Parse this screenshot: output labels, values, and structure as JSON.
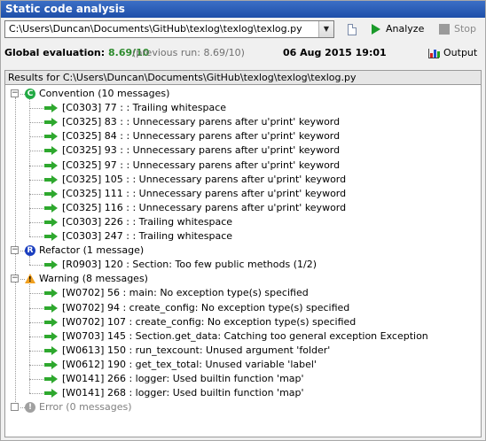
{
  "window": {
    "title": "Static code analysis"
  },
  "toolbar": {
    "file_path": "C:\\Users\\Duncan\\Documents\\GitHub\\texlog\\texlog\\texlog.py",
    "analyze_label": "Analyze",
    "stop_label": "Stop"
  },
  "evaluation": {
    "label": "Global evaluation:",
    "score": "8.69/10",
    "previous": "(previous run: 8.69/10)",
    "date": "06 Aug 2015 19:01",
    "output_label": "Output"
  },
  "results": {
    "header": "Results for C:\\Users\\Duncan\\Documents\\GitHub\\texlog\\texlog\\texlog.py",
    "categories": [
      {
        "label": "Convention (10 messages)",
        "icon": "convention-icon",
        "icon_letter": "C",
        "color": "#22aa44",
        "items": [
          "[C0303] 77 :  : Trailing whitespace",
          "[C0325] 83 :  : Unnecessary parens after u'print' keyword",
          "[C0325] 84 :  : Unnecessary parens after u'print' keyword",
          "[C0325] 93 :  : Unnecessary parens after u'print' keyword",
          "[C0325] 97 :  : Unnecessary parens after u'print' keyword",
          "[C0325] 105 :  : Unnecessary parens after u'print' keyword",
          "[C0325] 111 :  : Unnecessary parens after u'print' keyword",
          "[C0325] 116 :  : Unnecessary parens after u'print' keyword",
          "[C0303] 226 :  : Trailing whitespace",
          "[C0303] 247 :  : Trailing whitespace"
        ]
      },
      {
        "label": "Refactor (1 message)",
        "icon": "refactor-icon",
        "icon_letter": "R",
        "color": "#1b3fbf",
        "items": [
          "[R0903] 120 :  Section: Too few public methods (1/2)"
        ]
      },
      {
        "label": "Warning (8 messages)",
        "icon": "warning-icon",
        "icon_letter": "!",
        "color": "#f0a020",
        "items": [
          "[W0702] 56 :  main: No exception type(s) specified",
          "[W0702] 94 :  create_config: No exception type(s) specified",
          "[W0702] 107 :  create_config: No exception type(s) specified",
          "[W0703] 145 :  Section.get_data: Catching too general exception Exception",
          "[W0613] 150 :  run_texcount: Unused argument 'folder'",
          "[W0612] 190 :  get_tex_total: Unused variable 'label'",
          "[W0141] 266 :  logger: Used builtin function 'map'",
          "[W0141] 268 :  logger: Used builtin function 'map'"
        ]
      },
      {
        "label": "Error (0 messages)",
        "icon": "error-icon",
        "icon_letter": "!",
        "color": "#a0a0a0",
        "items": []
      }
    ]
  }
}
